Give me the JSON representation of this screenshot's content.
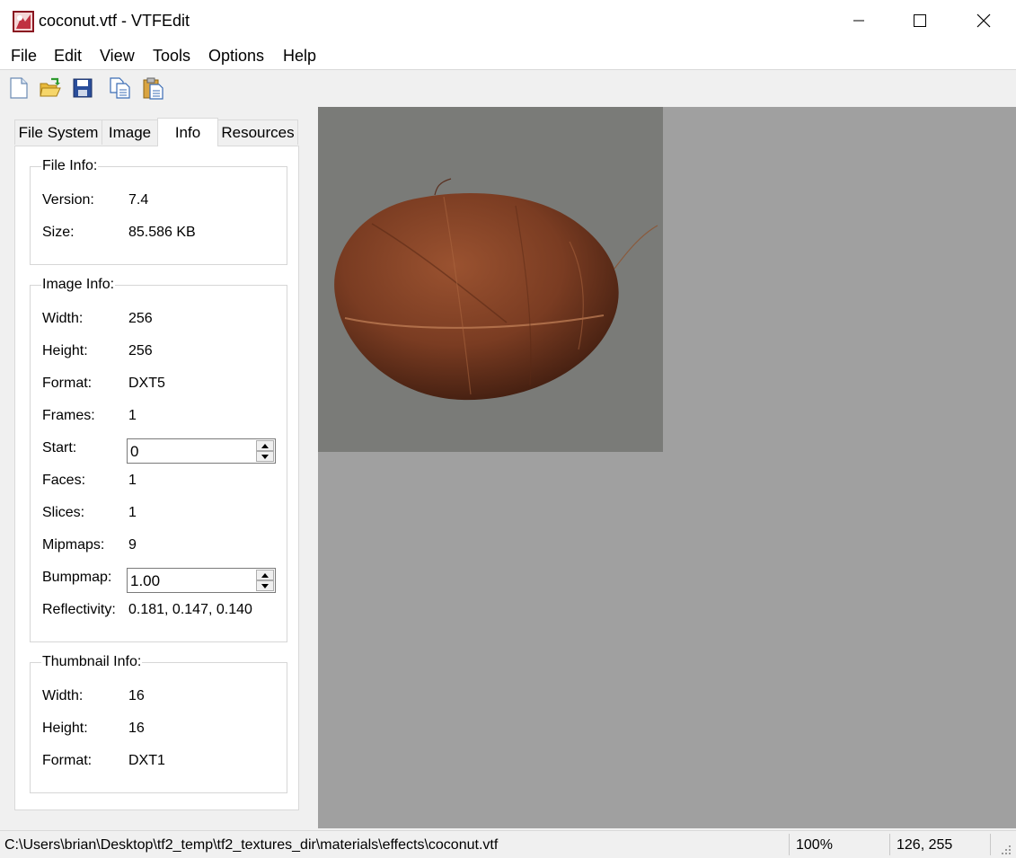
{
  "window": {
    "title": "coconut.vtf - VTFEdit"
  },
  "menu": {
    "items": [
      "File",
      "Edit",
      "View",
      "Tools",
      "Options",
      "Help"
    ]
  },
  "toolbar": {
    "icons": [
      "new-file-icon",
      "open-folder-icon",
      "save-icon",
      "copy-icon",
      "paste-icon"
    ]
  },
  "tabs": [
    "File System",
    "Image",
    "Info",
    "Resources"
  ],
  "active_tab": "Info",
  "file_info": {
    "title": "File Info:",
    "version_label": "Version:",
    "version": "7.4",
    "size_label": "Size:",
    "size": "85.586 KB"
  },
  "image_info": {
    "title": "Image Info:",
    "width_label": "Width:",
    "width": "256",
    "height_label": "Height:",
    "height": "256",
    "format_label": "Format:",
    "format": "DXT5",
    "frames_label": "Frames:",
    "frames": "1",
    "start_label": "Start:",
    "start": "0",
    "faces_label": "Faces:",
    "faces": "1",
    "slices_label": "Slices:",
    "slices": "1",
    "mipmaps_label": "Mipmaps:",
    "mipmaps": "9",
    "bumpmap_label": "Bumpmap:",
    "bumpmap": "1.00",
    "reflectivity_label": "Reflectivity:",
    "reflectivity": "0.181, 0.147, 0.140"
  },
  "thumbnail_info": {
    "title": "Thumbnail Info:",
    "width_label": "Width:",
    "width": "16",
    "height_label": "Height:",
    "height": "16",
    "format_label": "Format:",
    "format": "DXT1"
  },
  "status": {
    "path": "C:\\Users\\brian\\Desktop\\tf2_temp\\tf2_textures_dir\\materials\\effects\\coconut.vtf",
    "zoom": "100%",
    "coords": "126, 255"
  },
  "colors": {
    "viewer_bg": "#a0a0a0",
    "texture_bg": "#7a7b78",
    "coconut": "#7a3c22"
  }
}
